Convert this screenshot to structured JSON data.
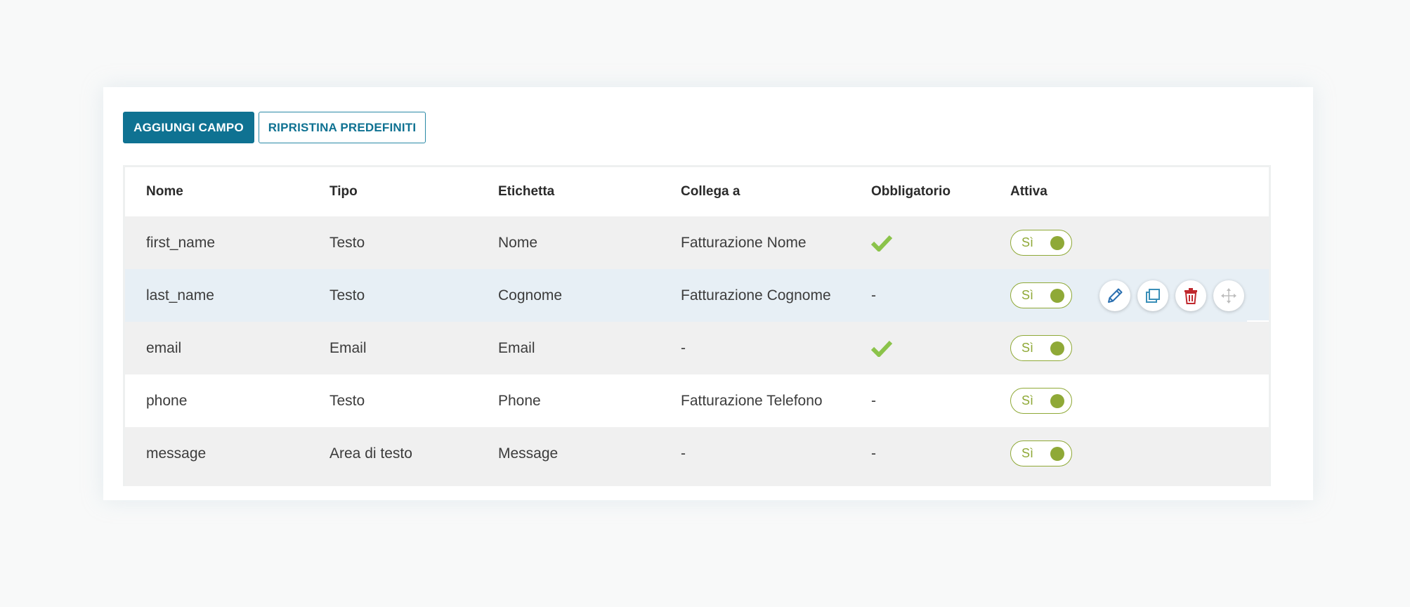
{
  "toolbar": {
    "add_label": "AGGIUNGI CAMPO",
    "reset_label": "RIPRISTINA PREDEFINITI"
  },
  "table": {
    "columns": {
      "nome": "Nome",
      "tipo": "Tipo",
      "etichetta": "Etichetta",
      "collega": "Collega a",
      "obbligatorio": "Obbligatorio",
      "attiva": "Attiva"
    },
    "rows": [
      {
        "nome": "first_name",
        "tipo": "Testo",
        "etichetta": "Nome",
        "collega": "Fatturazione Nome",
        "obbligatorio": "",
        "attiva": "Sì"
      },
      {
        "nome": "last_name",
        "tipo": "Testo",
        "etichetta": "Cognome",
        "collega": "Fatturazione Cognome",
        "obbligatorio": "-",
        "attiva": "Sì"
      },
      {
        "nome": "email",
        "tipo": "Email",
        "etichetta": "Email",
        "collega": "-",
        "obbligatorio": "",
        "attiva": "Sì"
      },
      {
        "nome": "phone",
        "tipo": "Testo",
        "etichetta": "Phone",
        "collega": "Fatturazione Telefono",
        "obbligatorio": "-",
        "attiva": "Sì"
      },
      {
        "nome": "message",
        "tipo": "Area di testo",
        "etichetta": "Message",
        "collega": "-",
        "obbligatorio": "-",
        "attiva": "Sì"
      }
    ],
    "required_icon": "checkmark-icon",
    "row_actions": [
      "edit-icon",
      "duplicate-icon",
      "delete-icon",
      "move-icon"
    ]
  },
  "colors": {
    "primary": "#0f7292",
    "toggle_on": "#8fa937",
    "check": "#8bc34a",
    "delete": "#c0282d",
    "hover_row": "#e7eff5"
  }
}
